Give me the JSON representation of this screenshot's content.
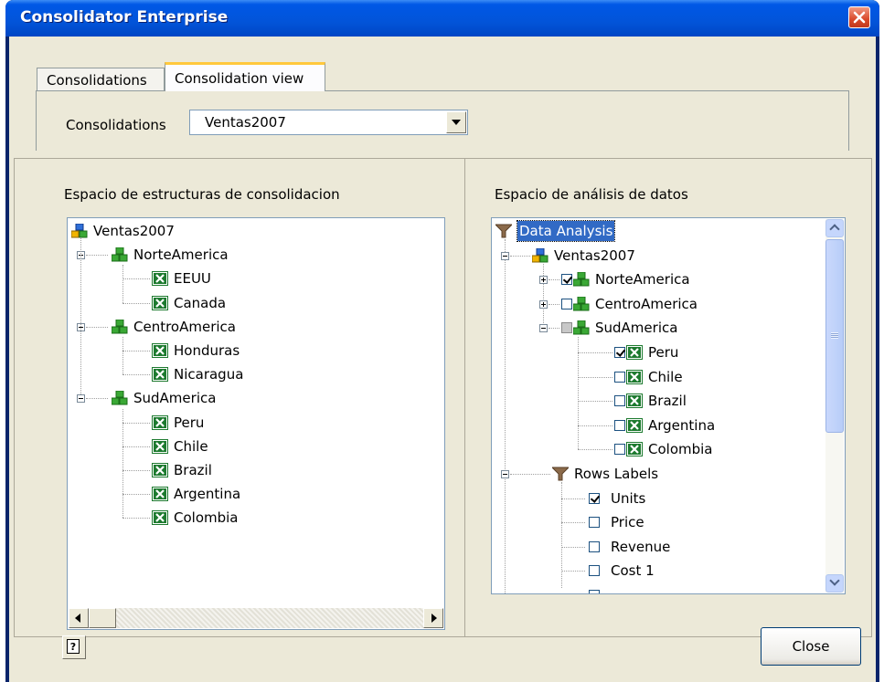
{
  "window": {
    "title": "Consolidator Enterprise"
  },
  "tabs": [
    {
      "label": "Consolidations",
      "selected": false
    },
    {
      "label": "Consolidation view",
      "selected": true
    }
  ],
  "consolidation_select": {
    "label": "Consolidations",
    "value": "Ventas2007"
  },
  "left_pane": {
    "label": "Espacio de estructuras de consolidacion",
    "tree": {
      "root": "Ventas2007",
      "groups": [
        {
          "name": "NorteAmerica",
          "items": [
            "EEUU",
            "Canada"
          ]
        },
        {
          "name": "CentroAmerica",
          "items": [
            "Honduras",
            "Nicaragua"
          ]
        },
        {
          "name": "SudAmerica",
          "items": [
            "Peru",
            "Chile",
            "Brazil",
            "Argentina",
            "Colombia"
          ]
        }
      ]
    }
  },
  "right_pane": {
    "label": "Espacio de análisis de datos",
    "tree": {
      "root": "Data Analysis",
      "consolidation": "Ventas2007",
      "groups": [
        {
          "name": "NorteAmerica",
          "state": "checked",
          "expanded": false
        },
        {
          "name": "CentroAmerica",
          "state": "unchecked",
          "expanded": false
        },
        {
          "name": "SudAmerica",
          "state": "partial",
          "expanded": true
        }
      ],
      "sud_items": [
        {
          "name": "Peru",
          "checked": true
        },
        {
          "name": "Chile",
          "checked": false
        },
        {
          "name": "Brazil",
          "checked": false
        },
        {
          "name": "Argentina",
          "checked": false
        },
        {
          "name": "Colombia",
          "checked": false
        }
      ],
      "rows_labels": "Rows Labels",
      "rows": [
        {
          "name": "Units",
          "checked": true
        },
        {
          "name": "Price",
          "checked": false
        },
        {
          "name": "Revenue",
          "checked": false
        },
        {
          "name": "Cost 1",
          "checked": false
        }
      ]
    }
  },
  "footer": {
    "help_label": "?",
    "close_label": "Close"
  },
  "colors": {
    "titlebar": "#0054e3",
    "client_bg": "#ece9d8",
    "selection": "#316ac5",
    "excel_green": "#1d7a2f"
  }
}
